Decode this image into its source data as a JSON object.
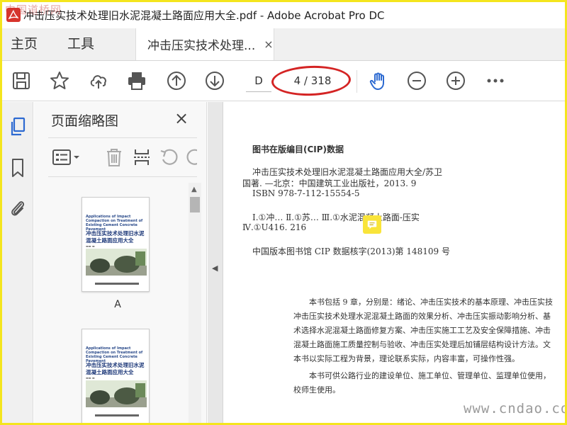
{
  "window": {
    "watermark": "中国道桥网",
    "title": "冲击压实技术处理旧水泥混凝土路面应用大全.pdf - Adobe Acrobat Pro DC"
  },
  "tabs": {
    "home": "主页",
    "tools": "工具",
    "document": "冲击压实技术处理...",
    "close": "×"
  },
  "toolbar": {
    "page_input": "D",
    "page_count": "4 / 318"
  },
  "thumbnails": {
    "title": "页面缩略图",
    "close": "×",
    "pages": [
      {
        "label": "A",
        "en_title": "Applications of Impact Compaction on Treatment of Existing Cement Concrete Pavement",
        "cn_title": "冲击压实技术处理旧水泥混凝土路面应用大全"
      },
      {
        "label": "",
        "en_title": "Applications of Impact Compaction on Treatment of Existing Cement Concrete Pavement",
        "cn_title": "冲击压实技术处理旧水泥混凝土路面应用大全"
      }
    ]
  },
  "document": {
    "cip_title": "图书在版编目(CIP)数据",
    "cip_lines": [
      "冲击压实技术处理旧水泥混凝土路面应用大全/苏卫",
      "国著. —北京：中国建筑工业出版社，2013. 9",
      "ISBN 978-7-112-15554-5"
    ],
    "class_lines": [
      "Ⅰ.①冲…   Ⅱ.①苏…   Ⅲ.①水泥混凝土路面-压实",
      "Ⅳ.①U416. 216"
    ],
    "cip_number": "中国版本图书馆 CIP 数据核字(2013)第 148109 号",
    "body_lines": [
      "本书包括 9 章，分别是：绪论、冲击压实技术的基本原理、冲击压实技",
      "冲击压实技术处理水泥混凝土路面的效果分析、冲击压实振动影响分析、基",
      "术选择水泥混凝土路面修复方案、冲击压实施工工艺及安全保障措施、冲击",
      "混凝土路面施工质量控制与验收、冲击压实处理后加铺层结构设计方法。文",
      "本书以实际工程为背景，理论联系实际，内容丰富，可操作性强。"
    ],
    "body_lines_2": [
      "本书可供公路行业的建设单位、施工单位、管理单位、监理单位使用，",
      "校师生使用。"
    ],
    "watermark": "www.cndao.com"
  },
  "colors": {
    "accent_blue": "#2d6ad1",
    "annotation_red": "#d42424",
    "frame_yellow": "#f4e51e",
    "note_yellow": "#f9e43a"
  }
}
